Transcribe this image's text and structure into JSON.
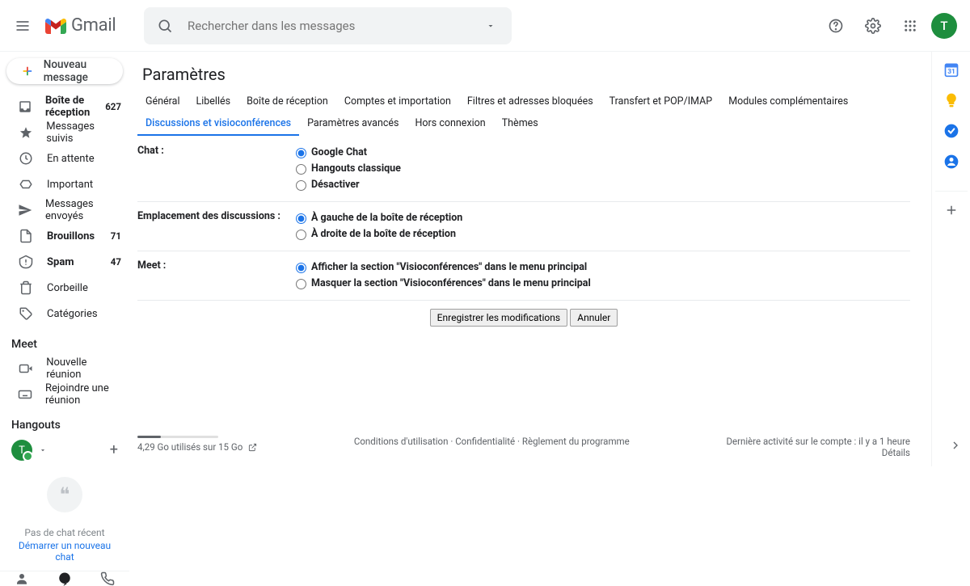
{
  "header": {
    "brand": "Gmail",
    "search_placeholder": "Rechercher dans les messages",
    "avatar_initial": "T"
  },
  "compose_label": "Nouveau message",
  "sidebar": {
    "items": [
      {
        "icon": "inbox",
        "label": "Boîte de réception",
        "count": "627",
        "bold": true
      },
      {
        "icon": "star",
        "label": "Messages suivis"
      },
      {
        "icon": "clock",
        "label": "En attente"
      },
      {
        "icon": "arrow",
        "label": "Important"
      },
      {
        "icon": "send",
        "label": "Messages envoyés"
      },
      {
        "icon": "file",
        "label": "Brouillons",
        "count": "71",
        "bold": true
      },
      {
        "icon": "spam",
        "label": "Spam",
        "count": "47",
        "bold": true
      },
      {
        "icon": "trash",
        "label": "Corbeille"
      },
      {
        "icon": "label",
        "label": "Catégories"
      }
    ],
    "meet_head": "Meet",
    "meet_items": [
      {
        "label": "Nouvelle réunion"
      },
      {
        "label": "Rejoindre une réunion"
      }
    ],
    "hangouts_head": "Hangouts",
    "hangouts_initial": "T",
    "no_chat": "Pas de chat récent",
    "start_chat": "Démarrer un nouveau chat"
  },
  "settings": {
    "title": "Paramètres",
    "tabs": [
      "Général",
      "Libellés",
      "Boîte de réception",
      "Comptes et importation",
      "Filtres et adresses bloquées",
      "Transfert et POP/IMAP",
      "Modules complémentaires",
      "Discussions et visioconférences",
      "Paramètres avancés",
      "Hors connexion",
      "Thèmes"
    ],
    "active_tab": 7,
    "sections": [
      {
        "label": "Chat :",
        "opts": [
          "Google Chat",
          "Hangouts classique",
          "Désactiver"
        ],
        "sel": 0
      },
      {
        "label": "Emplacement des discussions :",
        "opts": [
          "À gauche de la boîte de réception",
          "À droite de la boîte de réception"
        ],
        "sel": 0
      },
      {
        "label": "Meet :",
        "opts": [
          "Afficher la section \"Visioconférences\" dans le menu principal",
          "Masquer la section \"Visioconférences\" dans le menu principal"
        ],
        "sel": 0
      }
    ],
    "save": "Enregistrer les modifications",
    "cancel": "Annuler"
  },
  "footer": {
    "storage": "4,29 Go utilisés sur 15 Go",
    "links": [
      "Conditions d'utilisation",
      "Confidentialité",
      "Règlement du programme"
    ],
    "activity": "Dernière activité sur le compte : il y a 1 heure",
    "details": "Détails"
  }
}
